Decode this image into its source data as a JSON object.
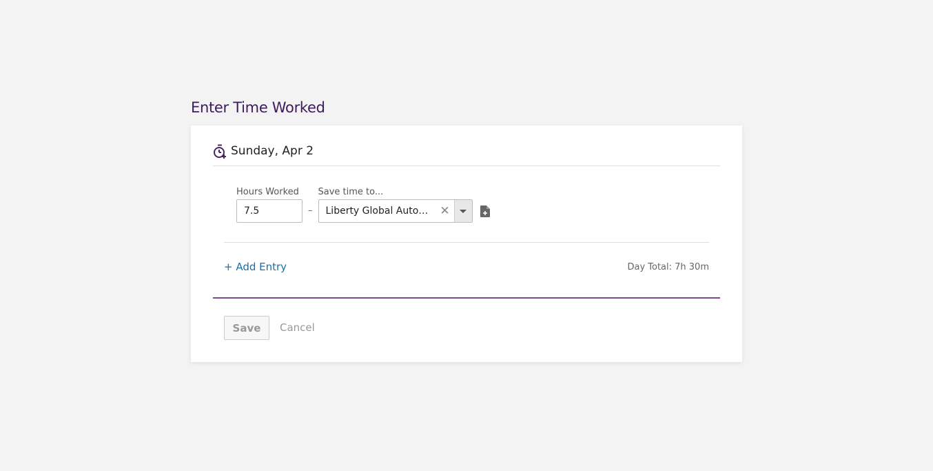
{
  "page": {
    "title": "Enter Time Worked"
  },
  "day": {
    "label": "Sunday, Apr 2",
    "icon": "stopwatch-plus-icon"
  },
  "entry": {
    "hours_label": "Hours Worked",
    "hours_value": "7.5",
    "separator": "–",
    "save_to_label": "Save time to...",
    "save_to_value": "Liberty Global Automa…",
    "clear_glyph": "✕",
    "note_icon": "document-plus-icon"
  },
  "actions": {
    "add_entry": "+ Add Entry",
    "day_total": "Day Total: 7h 30m",
    "save": "Save",
    "cancel": "Cancel"
  },
  "colors": {
    "title": "#3d1a5c",
    "link": "#1a6fa8",
    "rule": "#7b4a93"
  }
}
